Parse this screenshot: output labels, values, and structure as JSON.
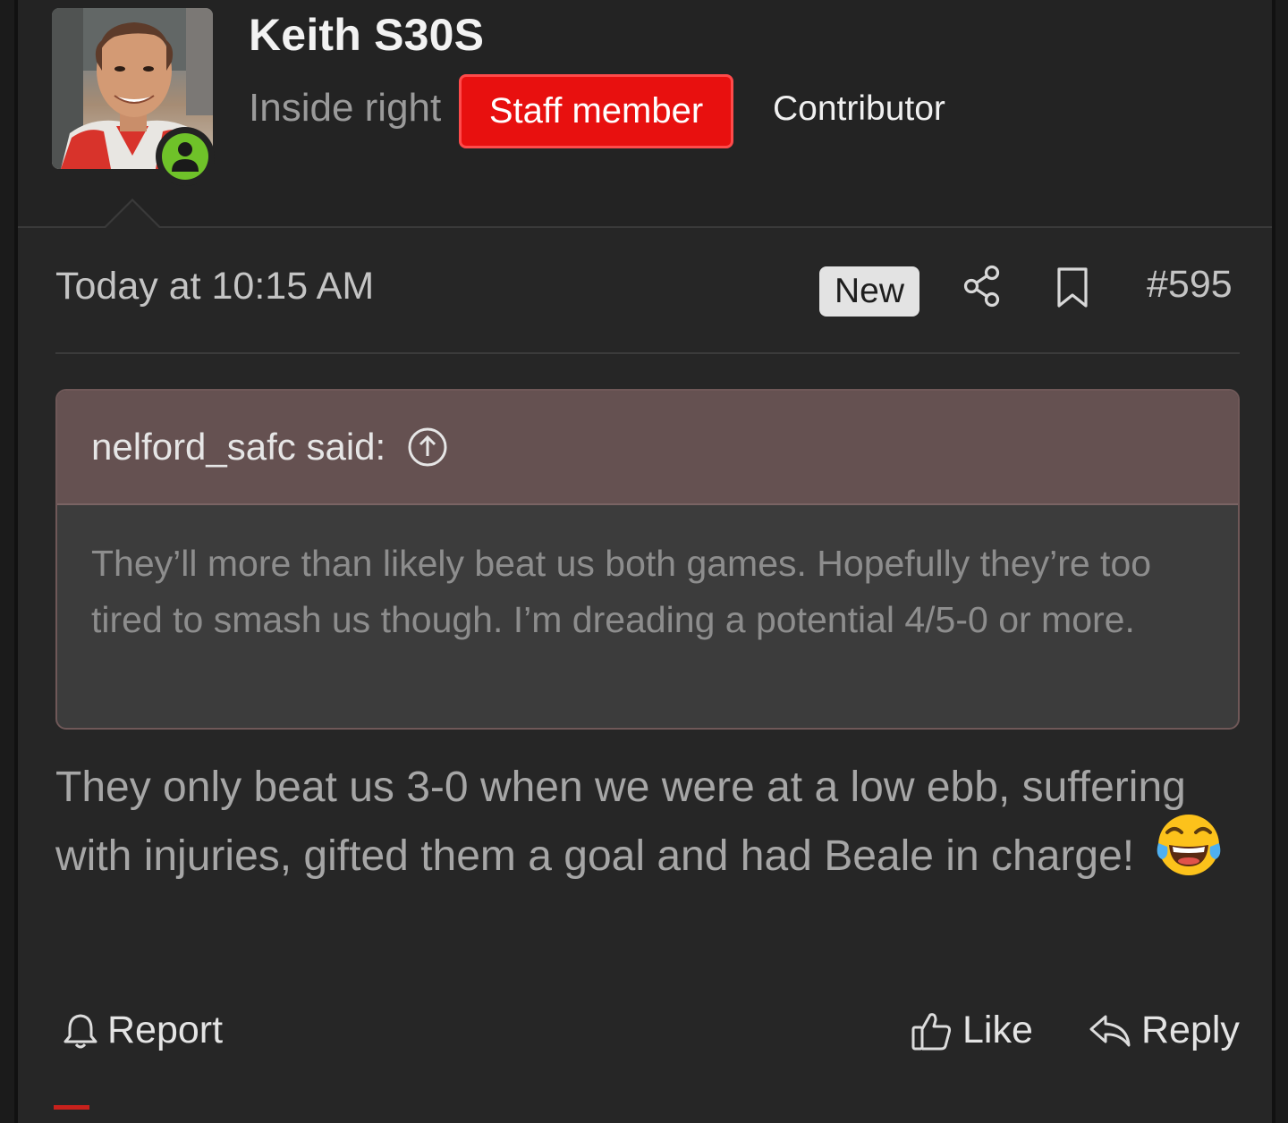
{
  "user": {
    "name": "Keith S30S",
    "title": "Inside right",
    "staff_badge": "Staff member",
    "role": "Contributor",
    "online_status_icon": "user-online-icon",
    "accent_online": "#6fc229",
    "accent_staff": "#e8100f"
  },
  "meta": {
    "date": "Today at 10:15 AM",
    "new_badge": "New",
    "share_icon": "share-icon",
    "bookmark_icon": "bookmark-icon",
    "post_number": "#595"
  },
  "quote": {
    "author": "nelford_safc said:",
    "jump_icon": "arrow-up-circle-icon",
    "text": "They’ll more than likely beat us both games. Hopefully they’re too tired to smash us though. I’m dreading a potential 4/5-0 or more."
  },
  "post": {
    "text": "They only beat us 3-0 when we were at a low ebb, suffering with injuries, gifted them a goal and had Beale in charge!",
    "emoji": "tears-of-joy-emoji"
  },
  "actions": {
    "report": "Report",
    "like": "Like",
    "reply": "Reply"
  }
}
